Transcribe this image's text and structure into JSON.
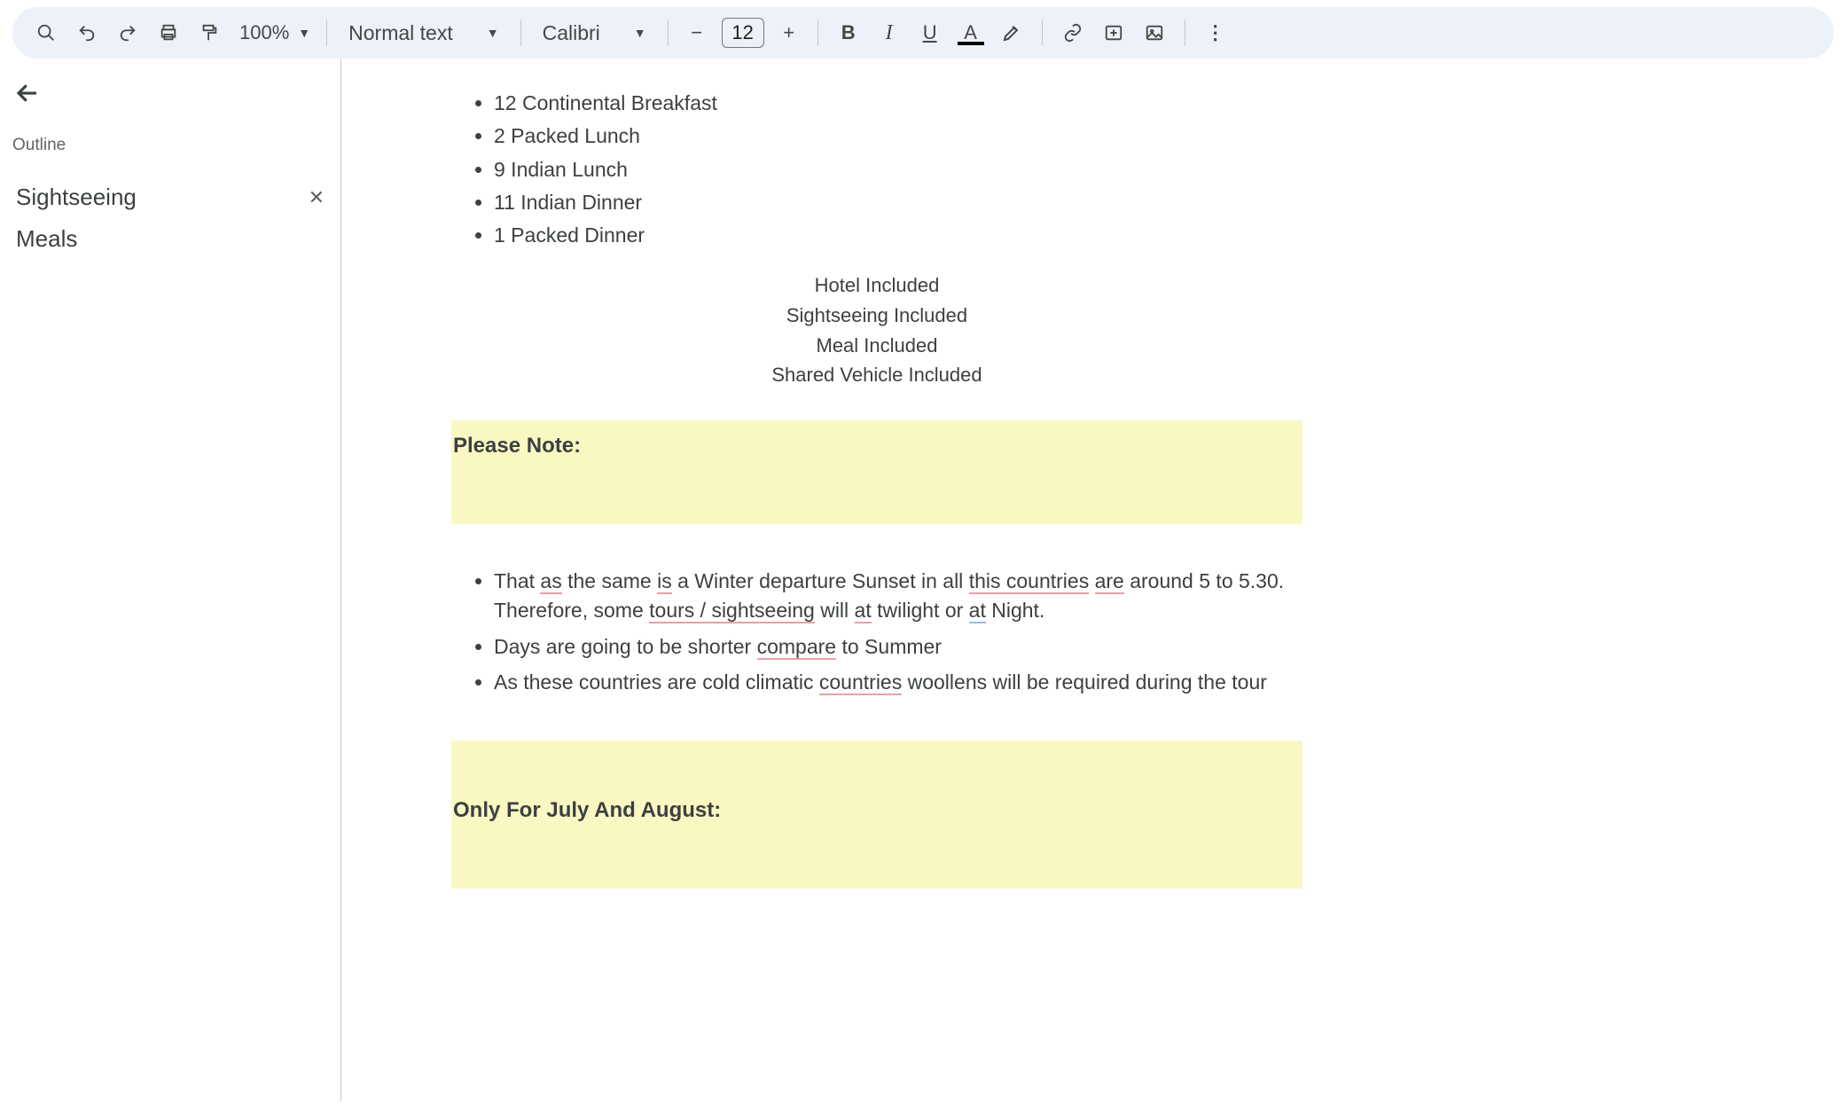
{
  "toolbar": {
    "zoom": "100%",
    "style": "Normal text",
    "font": "Calibri",
    "fontsize": "12",
    "icons": {
      "search": "search-icon",
      "undo": "undo-icon",
      "redo": "redo-icon",
      "print": "print-icon",
      "paint": "paint-format-icon",
      "minus": "−",
      "plus": "+",
      "bold": "B",
      "italic": "I",
      "underline": "U",
      "textcolor": "A",
      "link": "link-icon",
      "comment": "comment-icon",
      "image": "image-icon",
      "more": "⋮"
    }
  },
  "outline": {
    "title": "Outline",
    "items": [
      {
        "label": "Sightseeing",
        "active": true
      },
      {
        "label": "Meals",
        "active": false
      }
    ]
  },
  "document": {
    "meal_bullets": [
      "12 Continental Breakfast",
      "2 Packed Lunch",
      "9 Indian Lunch",
      "11 Indian Dinner",
      "1 Packed Dinner"
    ],
    "included_lines": [
      "Hotel Included",
      "Sightseeing Included",
      "Meal Included",
      "Shared Vehicle Included"
    ],
    "please_note_header": "Please Note:",
    "notes": {
      "n1a": "That ",
      "n1_as": "as",
      "n1b": " the same ",
      "n1_is": "is",
      "n1c": " a Winter departure Sunset in all ",
      "n1_this": "this countries",
      "n1d": " ",
      "n1_are": "are",
      "n1e": " around 5 to 5.30. Therefore, some ",
      "n1_ts": "tours / sightseeing",
      "n1f": " will ",
      "n1_at1": "at",
      "n1g": " twilight or ",
      "n1_at2": "at",
      "n1h": " Night.",
      "n2a": "Days are going to be shorter ",
      "n2_compare": "compare",
      "n2b": " to Summer",
      "n3a": "As these countries are cold climatic ",
      "n3_countries": "countries",
      "n3b": " woollens will be required during the tour"
    },
    "only_for_header": "Only For July And August:"
  }
}
